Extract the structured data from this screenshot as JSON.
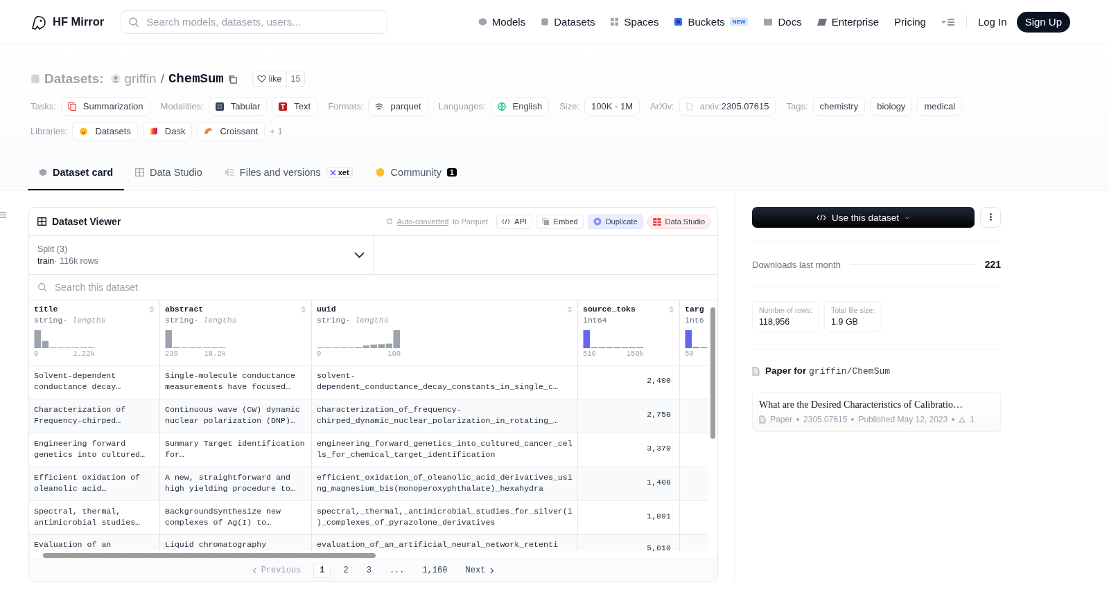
{
  "header": {
    "logo_text": "HF Mirror",
    "search_placeholder": "Search models, datasets, users...",
    "nav": [
      {
        "label": "Models"
      },
      {
        "label": "Datasets"
      },
      {
        "label": "Spaces"
      },
      {
        "label": "Buckets",
        "badge": "NEW"
      },
      {
        "label": "Docs"
      },
      {
        "label": "Enterprise"
      },
      {
        "label": "Pricing"
      }
    ],
    "login": "Log In",
    "signup": "Sign Up"
  },
  "title": {
    "type_label": "Datasets:",
    "owner": "griffin",
    "separator": "/",
    "name": "ChemSum",
    "like_label": "like",
    "like_count": "15"
  },
  "meta_rows": [
    [
      {
        "label": "Tasks:",
        "tags": [
          {
            "text": "Summarization"
          }
        ]
      },
      {
        "label": "Modalities:",
        "tags": [
          {
            "text": "Tabular"
          },
          {
            "text": "Text"
          }
        ]
      },
      {
        "label": "Formats:",
        "tags": [
          {
            "text": "parquet"
          }
        ]
      },
      {
        "label": "Languages:",
        "tags": [
          {
            "text": "English"
          }
        ]
      },
      {
        "label": "Size:",
        "tags": [
          {
            "text": "100K - 1M"
          }
        ]
      },
      {
        "label": "ArXiv:",
        "tags": [
          {
            "prefix": "arxiv:",
            "text": "2305.07615"
          }
        ]
      },
      {
        "label": "Tags:",
        "tags": [
          {
            "text": "chemistry"
          },
          {
            "text": "biology"
          },
          {
            "text": "medical"
          }
        ]
      }
    ],
    [
      {
        "label": "Libraries:",
        "tags": [
          {
            "text": "Datasets"
          },
          {
            "text": "Dask"
          },
          {
            "text": "Croissant"
          }
        ],
        "more": "+ 1"
      }
    ]
  ],
  "tabs": [
    {
      "label": "Dataset card",
      "selected": true
    },
    {
      "label": "Data Studio",
      "selected": false
    },
    {
      "label": "Files and versions",
      "selected": false,
      "badge": "xet"
    },
    {
      "label": "Community",
      "selected": false,
      "count": "1"
    }
  ],
  "viewer": {
    "title": "Dataset Viewer",
    "converted_link": "Auto-converted",
    "converted_rest": "to Parquet",
    "actions": [
      {
        "label": "API",
        "kind": "code"
      },
      {
        "label": "Embed",
        "kind": "embed"
      },
      {
        "label": "Duplicate",
        "kind": "duplicate"
      },
      {
        "label": "Data Studio",
        "kind": "studio"
      }
    ],
    "split_label": "Split (3)",
    "split_value": "train",
    "split_separator": "·",
    "split_rows": "116k rows",
    "search_placeholder": "Search this dataset",
    "columns": [
      {
        "name": "title",
        "dtype": "string",
        "kind": "string",
        "separator": "·",
        "note": "lengths",
        "min": "0",
        "max": "1.22k"
      },
      {
        "name": "abstract",
        "dtype": "string",
        "kind": "string",
        "separator": "·",
        "note": "lengths",
        "min": "239",
        "max": "18.2k"
      },
      {
        "name": "uuid",
        "dtype": "string",
        "kind": "string",
        "separator": "·",
        "note": "lengths",
        "min": "0",
        "max": "100"
      },
      {
        "name": "source_toks",
        "dtype": "int64",
        "kind": "number",
        "min": "510",
        "max": "159k"
      },
      {
        "name": "targ",
        "dtype": "int6",
        "kind": "number",
        "min": "50"
      }
    ],
    "rows": [
      [
        "Solvent-dependent conductance decay…",
        "Single-molecule conductance measurements have focused…",
        "solvent-dependent_conductance_decay_constants_in_single_c…",
        "2,400"
      ],
      [
        "Characterization of Frequency-chirped…",
        "Continuous wave (CW) dynamic nuclear polarization (DNP)…",
        "characterization_of_frequency-chirped_dynamic_nuclear_polarization_in_rotating_…",
        "2,758"
      ],
      [
        "Engineering forward genetics into cultured…",
        "Summary Target identification for…",
        "engineering_forward_genetics_into_cultured_cancer_cells_for_chemical_target_identification",
        "3,370"
      ],
      [
        "Efficient oxidation of oleanolic acid…",
        "A new, straightforward and high yielding procedure to…",
        "efficient_oxidation_of_oleanolic_acid_derivatives_using_magnesium_bis(monoperoxyphthalate)_hexahydra",
        "1,408"
      ],
      [
        "Spectral, thermal, antimicrobial studies…",
        "BackgroundSynthesize new complexes of Ag(I) to…",
        "spectral,_thermal,_antimicrobial_studies_for_silver(i)_complexes_of_pyrazolone_derivatives",
        "1,891"
      ],
      [
        "Evaluation of an",
        "Liquid chromatography",
        "evaluation_of_an_artificial_neural_network_retenti",
        "5,610"
      ]
    ],
    "pagination": {
      "previous": "Previous",
      "pages": [
        {
          "label": "1",
          "selected": true
        },
        {
          "label": "2",
          "selected": false
        },
        {
          "label": "3",
          "selected": false
        },
        {
          "label": "...",
          "selected": false
        },
        {
          "label": "1,160",
          "selected": false
        }
      ],
      "next": "Next"
    }
  },
  "side": {
    "use_button": "Use this dataset",
    "downloads_label": "Downloads last month",
    "downloads_value": "221",
    "stats": [
      {
        "label": "Number of rows:",
        "value": "118,956"
      },
      {
        "label": "Total file size:",
        "value": "1.9 GB"
      }
    ],
    "paper_heading": "Paper for",
    "paper_repo": "griffin/ChemSum",
    "paper": {
      "title": "What are the Desired Characteristics of Calibratio…",
      "kind_label": "Paper",
      "id": "2305.07615",
      "published": "Published May 12, 2023",
      "upvotes": "1"
    }
  }
}
